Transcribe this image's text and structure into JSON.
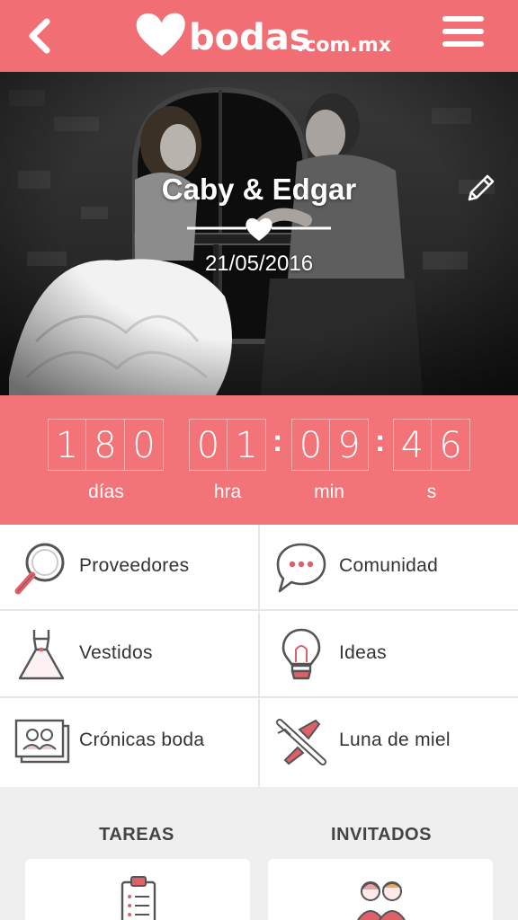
{
  "header": {
    "logo_text": "bodas",
    "logo_domain": ".com.mx",
    "back_icon": "chevron-left-icon",
    "menu_icon": "hamburger-icon"
  },
  "hero": {
    "couple_name": "Caby & Edgar",
    "date": "21/05/2016",
    "edit_icon": "pencil-icon"
  },
  "countdown": {
    "days_digits": [
      "1",
      "8",
      "0"
    ],
    "hours_digits": [
      "0",
      "1"
    ],
    "minutes_digits": [
      "0",
      "9"
    ],
    "seconds_digits": [
      "4",
      "6"
    ],
    "separator": ":",
    "labels": {
      "days": "días",
      "hours": "hra",
      "minutes": "min",
      "seconds": "s"
    }
  },
  "menu": {
    "items": [
      {
        "label": "Proveedores",
        "icon": "magnifier-icon"
      },
      {
        "label": "Comunidad",
        "icon": "chat-bubble-icon"
      },
      {
        "label": "Vestidos",
        "icon": "dress-icon"
      },
      {
        "label": "Ideas",
        "icon": "lightbulb-icon"
      },
      {
        "label": "Crónicas boda",
        "icon": "photo-album-icon"
      },
      {
        "label": "Luna de miel",
        "icon": "airplane-icon"
      }
    ]
  },
  "sections": {
    "tasks_title": "TAREAS",
    "guests_title": "INVITADOS"
  },
  "colors": {
    "brand": "#f06e74",
    "countdown_bg": "#f27378",
    "text": "#333333",
    "divider": "#e6e6e6",
    "background": "#efefef"
  }
}
